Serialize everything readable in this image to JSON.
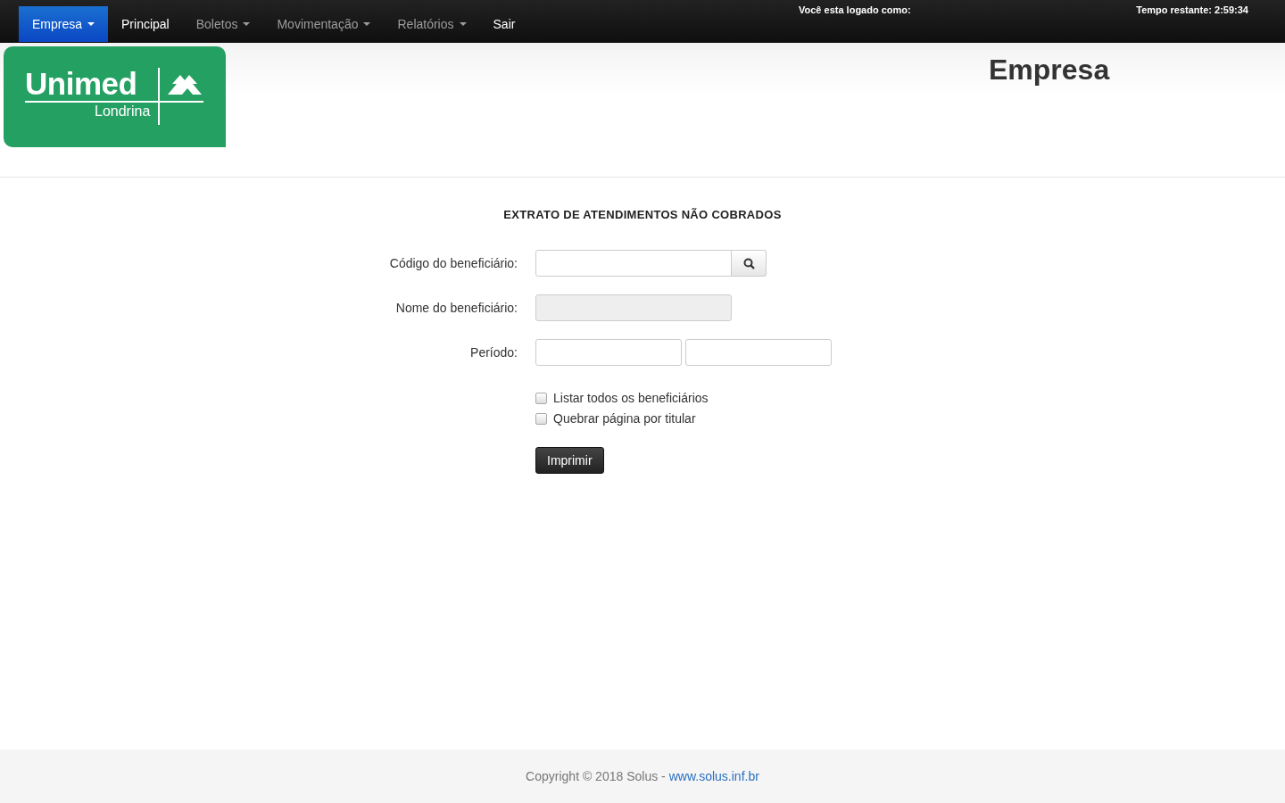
{
  "navbar": {
    "items": [
      {
        "label": "Empresa",
        "kind": "dropdown",
        "selected": true
      },
      {
        "label": "Principal",
        "kind": "link",
        "selected": false
      },
      {
        "label": "Boletos",
        "kind": "dropdown",
        "selected": false
      },
      {
        "label": "Movimentação",
        "kind": "dropdown",
        "selected": false
      },
      {
        "label": "Relatórios",
        "kind": "dropdown",
        "selected": false
      },
      {
        "label": "Sair",
        "kind": "link",
        "selected": false
      }
    ],
    "user_label": "Você esta logado como:",
    "time_remaining": "Tempo restante: 2:59:34"
  },
  "header": {
    "logo": {
      "name": "Unimed",
      "city": "Londrina"
    },
    "title": "Empresa"
  },
  "form": {
    "title": "EXTRATO DE ATENDIMENTOS NÃO COBRADOS",
    "fields": [
      {
        "label": "Código do beneficiário:",
        "kind": "search"
      },
      {
        "label": "Nome do beneficiário:",
        "kind": "disabled"
      },
      {
        "label": "Período:",
        "kind": "range"
      }
    ],
    "checkboxes": [
      {
        "label": "Listar todos os beneficiários",
        "checked": false
      },
      {
        "label": "Quebrar página por titular",
        "checked": false
      }
    ],
    "button": "Imprimir"
  },
  "footer": {
    "text": "Copyright © 2018 Solus -",
    "link": "www.solus.inf.br"
  }
}
